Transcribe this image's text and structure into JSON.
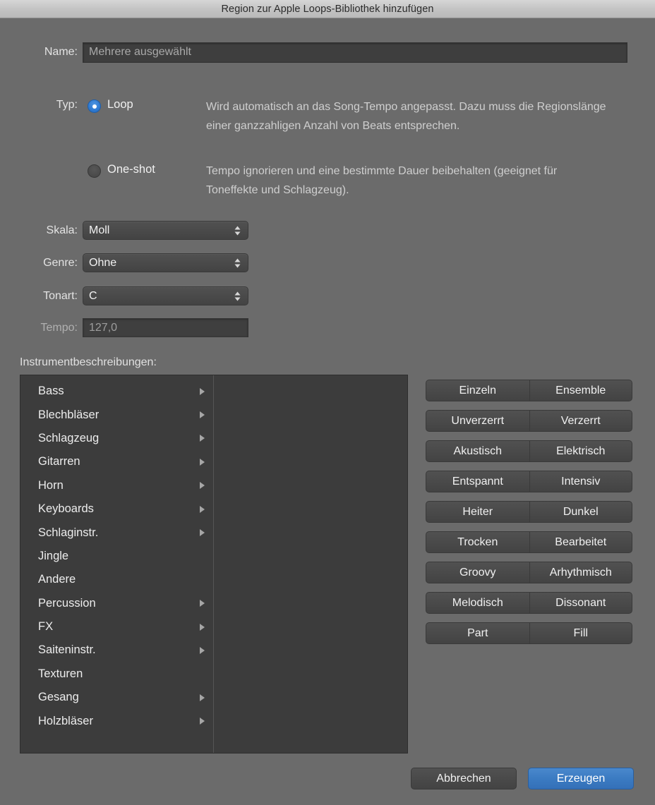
{
  "window": {
    "title": "Region zur Apple Loops-Bibliothek hinzufügen"
  },
  "form": {
    "name_label": "Name:",
    "name_value": "Mehrere ausgewählt",
    "typ_label": "Typ:",
    "radios": [
      {
        "label": "Loop",
        "selected": true,
        "description": "Wird automatisch an das Song-Tempo angepasst. Dazu muss die Regionslänge einer ganzzahligen Anzahl von Beats entsprechen."
      },
      {
        "label": "One-shot",
        "selected": false,
        "description": "Tempo ignorieren und eine bestimmte Dauer beibehalten (geeignet für Toneffekte und Schlagzeug)."
      }
    ],
    "selects": [
      {
        "label": "Skala:",
        "value": "Moll"
      },
      {
        "label": "Genre:",
        "value": "Ohne"
      },
      {
        "label": "Tonart:",
        "value": "C"
      }
    ],
    "tempo_label": "Tempo:",
    "tempo_value": "127,0"
  },
  "instruments": {
    "section_label": "Instrumentbeschreibungen:",
    "items": [
      {
        "label": "Bass",
        "has_submenu": true
      },
      {
        "label": "Blechbläser",
        "has_submenu": true
      },
      {
        "label": "Schlagzeug",
        "has_submenu": true
      },
      {
        "label": "Gitarren",
        "has_submenu": true
      },
      {
        "label": "Horn",
        "has_submenu": true
      },
      {
        "label": "Keyboards",
        "has_submenu": true
      },
      {
        "label": "Schlaginstr.",
        "has_submenu": true
      },
      {
        "label": "Jingle",
        "has_submenu": false
      },
      {
        "label": "Andere",
        "has_submenu": false
      },
      {
        "label": "Percussion",
        "has_submenu": true
      },
      {
        "label": "FX",
        "has_submenu": true
      },
      {
        "label": "Saiteninstr.",
        "has_submenu": true
      },
      {
        "label": "Texturen",
        "has_submenu": false
      },
      {
        "label": "Gesang",
        "has_submenu": true
      },
      {
        "label": "Holzbläser",
        "has_submenu": true
      }
    ]
  },
  "segments": [
    {
      "left": "Einzeln",
      "right": "Ensemble"
    },
    {
      "left": "Unverzerrt",
      "right": "Verzerrt"
    },
    {
      "left": "Akustisch",
      "right": "Elektrisch"
    },
    {
      "left": "Entspannt",
      "right": "Intensiv"
    },
    {
      "left": "Heiter",
      "right": "Dunkel"
    },
    {
      "left": "Trocken",
      "right": "Bearbeitet"
    },
    {
      "left": "Groovy",
      "right": "Arhythmisch"
    },
    {
      "left": "Melodisch",
      "right": "Dissonant"
    },
    {
      "left": "Part",
      "right": "Fill"
    }
  ],
  "footer": {
    "cancel_label": "Abbrechen",
    "create_label": "Erzeugen"
  },
  "colors": {
    "background": "#6b6b6b",
    "titlebar": "#c4c4c4",
    "field_dark": "#3e3e3e",
    "control_gray": "#4a4a4a",
    "accent_blue": "#3b7bc2",
    "list_background": "#3c3c3c"
  }
}
